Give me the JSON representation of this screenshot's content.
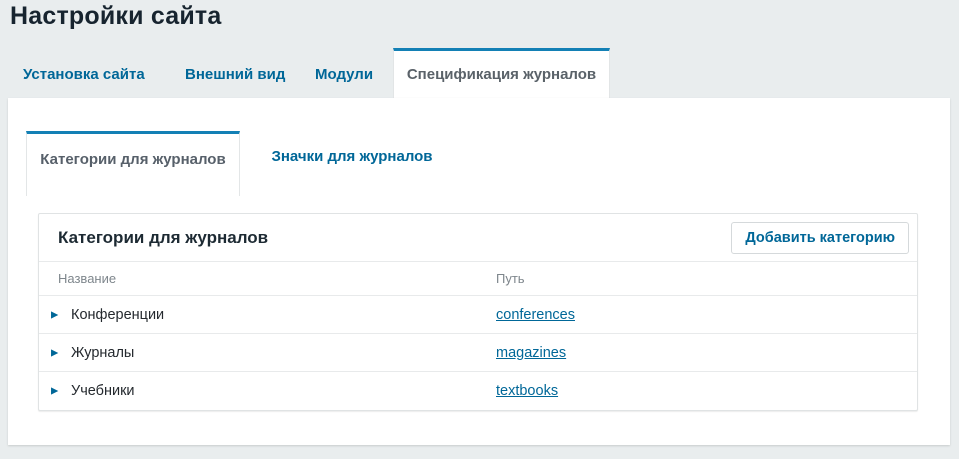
{
  "page_title": "Настройки сайта",
  "main_tabs": {
    "items": [
      {
        "label": "Установка сайта",
        "active": false
      },
      {
        "label": "Внешний вид",
        "active": false
      },
      {
        "label": "Модули",
        "active": false
      },
      {
        "label": "Спецификация журналов",
        "active": true
      }
    ]
  },
  "sub_tabs": {
    "items": [
      {
        "label": "Категории для журналов",
        "active": true
      },
      {
        "label": "Значки для журналов",
        "active": false
      }
    ]
  },
  "categories_panel": {
    "title": "Категории для журналов",
    "add_button_label": "Добавить категорию",
    "columns": {
      "name": "Название",
      "path": "Путь"
    },
    "rows": [
      {
        "name": "Конференции",
        "path": "conferences",
        "expander_icon": "triangle-right"
      },
      {
        "name": "Журналы",
        "path": "magazines",
        "expander_icon": "triangle-right"
      },
      {
        "name": "Учебники",
        "path": "textbooks",
        "expander_icon": "triangle-right"
      }
    ]
  },
  "icons": {
    "expander_glyph": "▶"
  },
  "colors": {
    "accent_blue": "#006798",
    "active_tab_border": "#1380b5",
    "page_background": "#e9edee",
    "heading_text": "#17242f",
    "muted_text": "#7e868c"
  }
}
